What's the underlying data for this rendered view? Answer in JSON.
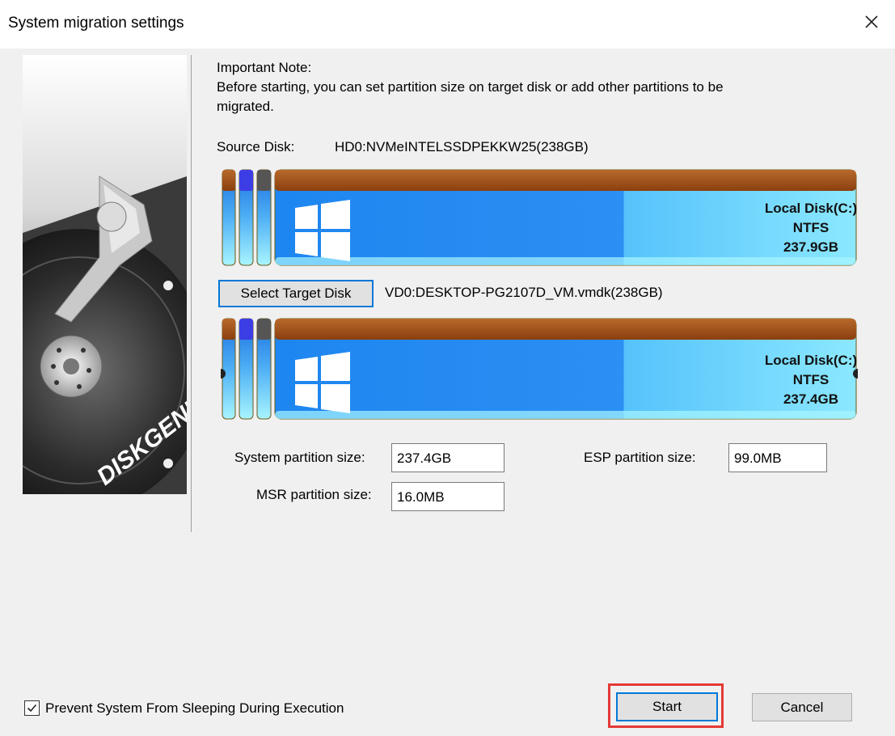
{
  "window": {
    "title": "System migration settings",
    "close_icon": "close-icon"
  },
  "side_image": {
    "logo_text": "DISKGENIUS"
  },
  "note": {
    "heading": "Important Note:",
    "line1": "Before starting, you can set partition size on target disk or add other partitions to be",
    "line2": "migrated."
  },
  "source": {
    "label": "Source Disk:",
    "name": "HD0:NVMeINTELSSDPEKKW25(238GB)",
    "partition": {
      "name": "Local Disk(C:)",
      "fs": "NTFS",
      "size": "237.9GB"
    }
  },
  "target": {
    "button_label": "Select Target Disk",
    "name": "VD0:DESKTOP-PG2107D_VM.vmdk(238GB)",
    "partition": {
      "name": "Local Disk(C:)",
      "fs": "NTFS",
      "size": "237.4GB"
    }
  },
  "sizes": {
    "system_label": "System partition size:",
    "system_value": "237.4GB",
    "esp_label": "ESP partition size:",
    "esp_value": "99.0MB",
    "msr_label": "MSR partition size:",
    "msr_value": "16.0MB"
  },
  "footer": {
    "checkbox_label": "Prevent System From Sleeping During Execution",
    "checkbox_checked": true,
    "start_label": "Start",
    "cancel_label": "Cancel"
  },
  "colors": {
    "partition_top": "#a0521a",
    "partition_body_light": "#8be8ff",
    "partition_body_dark": "#1e7de8",
    "selected_small": "#3a3ae0",
    "highlight": "#e53935"
  }
}
